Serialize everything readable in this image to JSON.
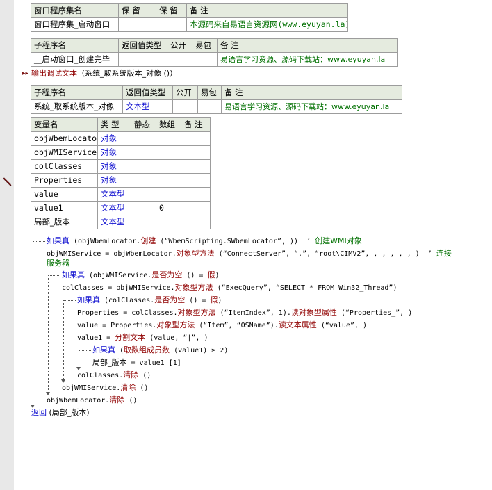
{
  "table_window": {
    "headers": [
      "窗口程序集名",
      "保 留",
      "保 留",
      "备 注"
    ],
    "row": [
      "窗口程序集_启动窗口",
      "",
      "",
      "本源码来自易语言资源网(www.eyuyan.la)"
    ]
  },
  "table_sub1": {
    "headers": [
      "子程序名",
      "返回值类型",
      "公开",
      "易包",
      "备 注"
    ],
    "row": [
      "__启动窗口_创建完毕",
      "",
      "",
      "",
      "易语言学习资源、源码下载站：www.eyuyan.la"
    ]
  },
  "debug_line": {
    "fn": "输出调试文本",
    "arg": "（系统_取系统版本_对像 ()）"
  },
  "table_sub2": {
    "headers": [
      "子程序名",
      "返回值类型",
      "公开",
      "易包",
      "备 注"
    ],
    "row": [
      "系统_取系统版本_对像",
      "文本型",
      "",
      "",
      "易语言学习资源、源码下载站：www.eyuyan.la"
    ]
  },
  "table_vars": {
    "headers": [
      "变量名",
      "类 型",
      "静态",
      "数组",
      "备 注"
    ],
    "rows": [
      [
        "objWbemLocator",
        "对象",
        "",
        "",
        ""
      ],
      [
        "objWMIService",
        "对象",
        "",
        "",
        ""
      ],
      [
        "colClasses",
        "对象",
        "",
        "",
        ""
      ],
      [
        "Properties",
        "对象",
        "",
        "",
        ""
      ],
      [
        "value",
        "文本型",
        "",
        "",
        ""
      ],
      [
        "value1",
        "文本型",
        "",
        "0",
        ""
      ],
      [
        "局部_版本",
        "文本型",
        "",
        "",
        ""
      ]
    ]
  },
  "code": {
    "l1a": "如果真",
    "l1b": " (objWbemLocator.",
    "l1c": "创建",
    "l1d": " (“WbemScripting.SWbemLocator”, ))  ’ ",
    "l1e": "创建WMI对象",
    "l2a": "objWMIService = objWbemLocator.",
    "l2b": "对象型方法",
    "l2c": " (“ConnectServer”, “.”, “root\\CIMV2”, , , , , , )  ’ ",
    "l2d": "连接",
    "l2e": "服务器",
    "l3a": "如果真",
    "l3b": " (objWMIService.",
    "l3c": "是否为空",
    "l3d": " () = ",
    "l3e": "假",
    "l3f": ")",
    "l4a": "colClasses = objWMIService.",
    "l4b": "对象型方法",
    "l4c": " (“ExecQuery”, “SELECT * FROM Win32_Thread”)",
    "l5a": "如果真",
    "l5b": " (colClasses.",
    "l5c": "是否为空",
    "l5d": " () = ",
    "l5e": "假",
    "l5f": ")",
    "l6a": "Properties = colClasses.",
    "l6b": "对象型方法",
    "l6c": " (“ItemIndex”, 1).",
    "l6d": "读对象型属性",
    "l6e": " (“Properties_”, )",
    "l7a": "value = Properties.",
    "l7b": "对象型方法",
    "l7c": " (“Item”, “OSName”).",
    "l7d": "读文本属性",
    "l7e": " (“value”, )",
    "l8a": "value1 = ",
    "l8b": "分割文本",
    "l8c": " (value, “|”, )",
    "l9a": "如果真",
    "l9b": " (",
    "l9c": "取数组成员数",
    "l9d": " (value1) ≥ 2)",
    "l10a": "局部_版本",
    "l10b": " = value1 [1]",
    "l11a": "colClasses.",
    "l11b": "清除",
    "l11c": " ()",
    "l12a": "objWMIService.",
    "l12b": "清除",
    "l12c": " ()",
    "l13a": "objWbemLocator.",
    "l13b": "清除",
    "l13c": " ()",
    "l14a": "返回",
    "l14b": " (",
    "l14c": "局部_版本",
    "l14d": ")"
  },
  "colors": {
    "header_bg": "#e5ebdf",
    "keyword": "#1010d0",
    "comment": "#007000",
    "function": "#900000"
  },
  "icons": {
    "gutter_marker": "pen-icon",
    "expand_marker": "double-arrow-icon"
  }
}
